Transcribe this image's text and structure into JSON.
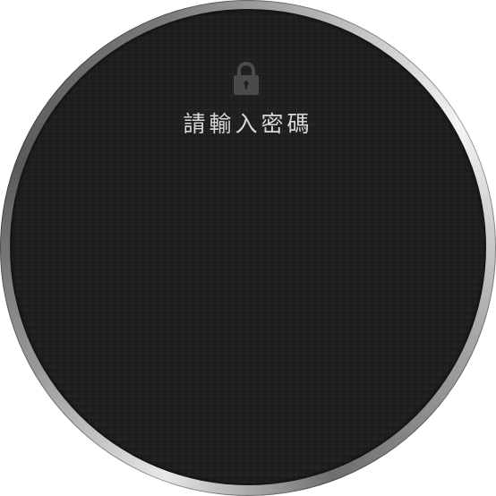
{
  "lock_screen": {
    "icon": "lock-icon",
    "prompt_text": "請輸入密碼"
  },
  "colors": {
    "screen_background": "#1e1e1e",
    "text": "#d8d8d8",
    "icon": "#4a4a4a"
  }
}
